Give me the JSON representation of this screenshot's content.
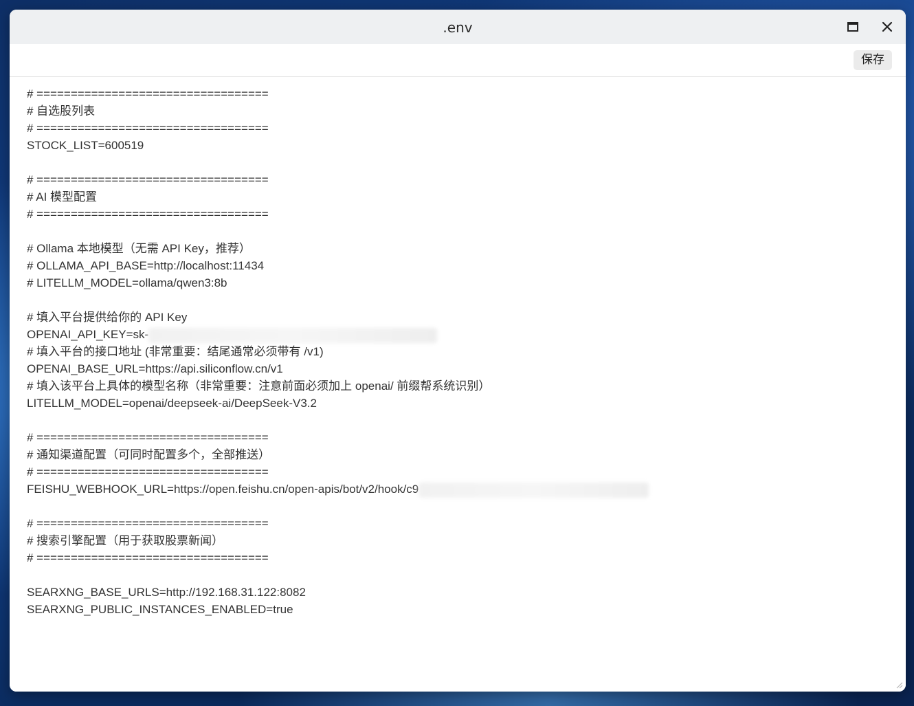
{
  "window": {
    "title": ".env"
  },
  "toolbar": {
    "save_label": "保存"
  },
  "editor": {
    "lines": [
      "# ==================================",
      "# 自选股列表",
      "# ==================================",
      "STOCK_LIST=600519",
      "",
      "# ==================================",
      "# AI 模型配置",
      "# ==================================",
      "",
      "# Ollama 本地模型（无需 API Key，推荐）",
      "# OLLAMA_API_BASE=http://localhost:11434",
      "# LITELLM_MODEL=ollama/qwen3:8b",
      "",
      "# 填入平台提供给你的 API Key",
      "OPENAI_API_KEY=sk-",
      "# 填入平台的接口地址 (非常重要：结尾通常必须带有 /v1)",
      "OPENAI_BASE_URL=https://api.siliconflow.cn/v1",
      "# 填入该平台上具体的模型名称（非常重要：注意前面必须加上 openai/ 前缀帮系统识别）",
      "LITELLM_MODEL=openai/deepseek-ai/DeepSeek-V3.2",
      "",
      "# ==================================",
      "# 通知渠道配置（可同时配置多个，全部推送）",
      "# ==================================",
      "FEISHU_WEBHOOK_URL=https://open.feishu.cn/open-apis/bot/v2/hook/c9",
      "",
      "# ==================================",
      "# 搜索引擎配置（用于获取股票新闻）",
      "# ==================================",
      "",
      "SEARXNG_BASE_URLS=http://192.168.31.122:8082",
      "SEARXNG_PUBLIC_INSTANCES_ENABLED=true"
    ]
  },
  "icons": {
    "maximize": "maximize-icon",
    "close": "close-icon",
    "resize": "resize-grip-icon"
  }
}
